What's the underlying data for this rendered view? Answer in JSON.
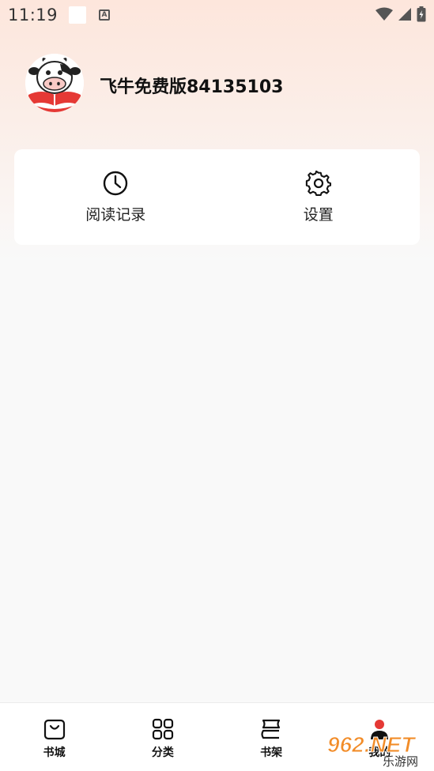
{
  "status_bar": {
    "time": "11:19",
    "icons": [
      "notification-blank-icon",
      "a-keyboard-icon",
      "wifi-icon",
      "signal-icon",
      "battery-charging-icon"
    ]
  },
  "profile": {
    "username": "飞牛免费版84135103",
    "avatar_icon": "cow-reading-book-icon"
  },
  "menu": [
    {
      "label": "阅读记录",
      "icon": "clock-icon"
    },
    {
      "label": "设置",
      "icon": "gear-icon"
    }
  ],
  "bottom_nav": [
    {
      "label": "书城",
      "icon": "shopping-bag-icon"
    },
    {
      "label": "分类",
      "icon": "grid-icon"
    },
    {
      "label": "书架",
      "icon": "bookshelf-icon"
    },
    {
      "label": "我的",
      "icon": "profile-icon",
      "active": true
    }
  ],
  "watermark": {
    "brand": "962.NET",
    "sub": "乐游网"
  },
  "colors": {
    "header_gradient_top": "#fde6dc",
    "background": "#f9f9f9",
    "accent_red": "#e53935"
  }
}
